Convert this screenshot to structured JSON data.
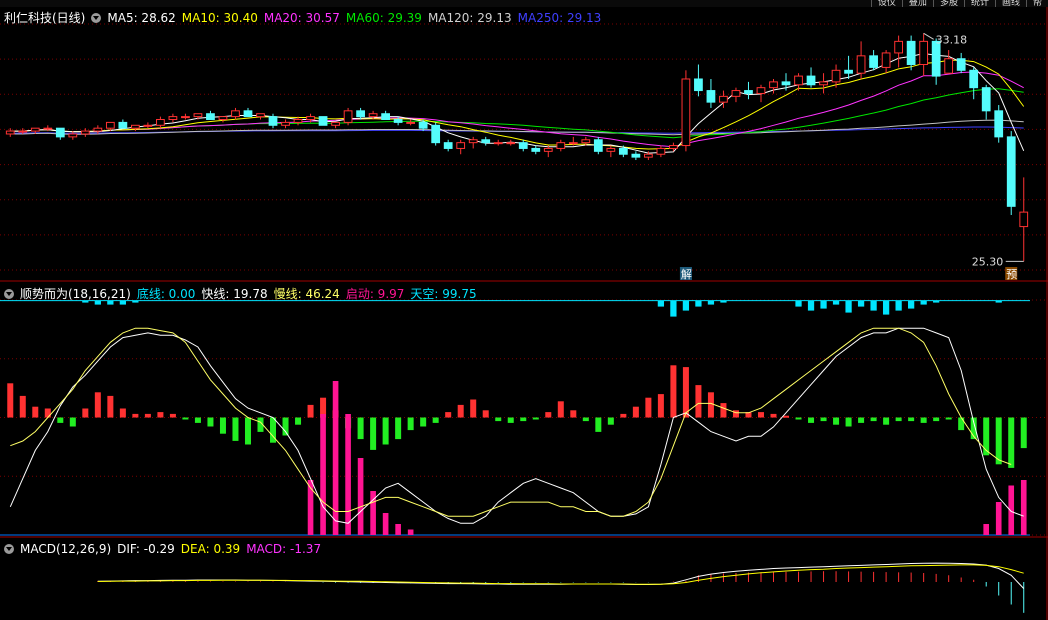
{
  "toolbar": {
    "right_buttons": [
      "设仪",
      "叠加",
      "多股",
      "统计",
      "画线",
      "帮"
    ]
  },
  "colors": {
    "up": "#ff3232",
    "down": "#54fcfc",
    "ma5": "#ffffff",
    "ma10": "#ffff00",
    "ma20": "#ff33ff",
    "ma60": "#00e600",
    "ma120": "#c0c0c0",
    "ma250": "#3f3fff",
    "fast": "#ffffff",
    "slow": "#ffff66",
    "start": "#ff1493",
    "sky": "#00e5ff",
    "grid": "#7a0000"
  },
  "main_legend": {
    "name": "利仁科技(日线)",
    "ma5": "MA5: 28.62",
    "ma10": "MA10: 30.40",
    "ma20": "MA20: 30.57",
    "ma60": "MA60: 29.39",
    "ma120": "MA120: 29.13",
    "ma250": "MA250: 29.13"
  },
  "ind_legend": {
    "name": "顺势而为(18,16,21)",
    "base": "底线: 0.00",
    "fast": "快线: 19.78",
    "slow": "慢线: 46.24",
    "start": "启动: 9.97",
    "sky": "天空: 99.75"
  },
  "macd_legend": {
    "name": "MACD(12,26,9)",
    "dif": "DIF: -0.29",
    "dea": "DEA: 0.39",
    "macd": "MACD: -1.37"
  },
  "chart_data": {
    "type": "candlestick",
    "high_label": "33.18",
    "low_label": "25.30",
    "markers": {
      "unlock": "解",
      "forecast": "预"
    },
    "price_range": [
      25.0,
      33.5
    ],
    "candles": [
      [
        29.7,
        29.9,
        29.6,
        29.8
      ],
      [
        29.8,
        29.9,
        29.7,
        29.8
      ],
      [
        29.8,
        29.9,
        29.7,
        29.9
      ],
      [
        29.9,
        30.0,
        29.8,
        29.9
      ],
      [
        29.9,
        29.9,
        29.5,
        29.6
      ],
      [
        29.6,
        29.8,
        29.5,
        29.7
      ],
      [
        29.7,
        29.9,
        29.6,
        29.8
      ],
      [
        29.8,
        30.0,
        29.7,
        29.9
      ],
      [
        29.9,
        30.1,
        29.8,
        30.1
      ],
      [
        30.1,
        30.2,
        29.9,
        29.9
      ],
      [
        29.9,
        30.0,
        29.8,
        30.0
      ],
      [
        30.0,
        30.1,
        29.9,
        30.0
      ],
      [
        30.0,
        30.3,
        29.9,
        30.2
      ],
      [
        30.2,
        30.4,
        30.1,
        30.3
      ],
      [
        30.3,
        30.4,
        30.2,
        30.3
      ],
      [
        30.3,
        30.4,
        30.2,
        30.4
      ],
      [
        30.4,
        30.5,
        30.2,
        30.2
      ],
      [
        30.2,
        30.3,
        30.1,
        30.3
      ],
      [
        30.3,
        30.6,
        30.2,
        30.5
      ],
      [
        30.5,
        30.6,
        30.3,
        30.3
      ],
      [
        30.3,
        30.4,
        30.2,
        30.4
      ],
      [
        30.3,
        30.4,
        29.9,
        30.0
      ],
      [
        30.0,
        30.2,
        29.9,
        30.1
      ],
      [
        30.1,
        30.3,
        30.0,
        30.2
      ],
      [
        30.2,
        30.4,
        30.1,
        30.3
      ],
      [
        30.3,
        30.3,
        30.0,
        30.0
      ],
      [
        30.0,
        30.1,
        29.9,
        30.1
      ],
      [
        30.1,
        30.6,
        30.0,
        30.5
      ],
      [
        30.5,
        30.6,
        30.2,
        30.3
      ],
      [
        30.3,
        30.5,
        30.2,
        30.4
      ],
      [
        30.4,
        30.5,
        30.2,
        30.2
      ],
      [
        30.2,
        30.3,
        30.0,
        30.1
      ],
      [
        30.1,
        30.2,
        30.0,
        30.1
      ],
      [
        30.1,
        30.2,
        29.8,
        29.9
      ],
      [
        30.0,
        30.1,
        29.3,
        29.4
      ],
      [
        29.4,
        29.5,
        29.1,
        29.2
      ],
      [
        29.2,
        29.5,
        29.0,
        29.4
      ],
      [
        29.4,
        29.6,
        29.2,
        29.5
      ],
      [
        29.5,
        29.6,
        29.3,
        29.4
      ],
      [
        29.4,
        29.5,
        29.3,
        29.4
      ],
      [
        29.4,
        29.5,
        29.3,
        29.4
      ],
      [
        29.4,
        29.5,
        29.1,
        29.2
      ],
      [
        29.2,
        29.3,
        29.0,
        29.1
      ],
      [
        29.1,
        29.3,
        28.9,
        29.2
      ],
      [
        29.2,
        29.5,
        29.1,
        29.4
      ],
      [
        29.4,
        29.6,
        29.3,
        29.4
      ],
      [
        29.4,
        29.6,
        29.3,
        29.5
      ],
      [
        29.5,
        29.6,
        29.0,
        29.1
      ],
      [
        29.1,
        29.3,
        28.9,
        29.2
      ],
      [
        29.2,
        29.3,
        28.9,
        29.0
      ],
      [
        29.0,
        29.1,
        28.8,
        28.9
      ],
      [
        28.9,
        29.1,
        28.8,
        29.0
      ],
      [
        29.0,
        29.3,
        28.9,
        29.2
      ],
      [
        29.2,
        29.4,
        29.1,
        29.3
      ],
      [
        29.3,
        31.9,
        29.1,
        31.6
      ],
      [
        31.6,
        32.1,
        31.0,
        31.2
      ],
      [
        31.2,
        31.6,
        30.6,
        30.8
      ],
      [
        30.8,
        31.2,
        30.6,
        31.0
      ],
      [
        31.0,
        31.3,
        30.8,
        31.2
      ],
      [
        31.2,
        31.5,
        30.9,
        31.1
      ],
      [
        31.1,
        31.4,
        30.8,
        31.3
      ],
      [
        31.3,
        31.6,
        31.1,
        31.5
      ],
      [
        31.5,
        31.8,
        31.2,
        31.4
      ],
      [
        31.4,
        31.8,
        31.2,
        31.7
      ],
      [
        31.7,
        32.0,
        31.3,
        31.4
      ],
      [
        31.4,
        31.8,
        31.1,
        31.5
      ],
      [
        31.5,
        32.1,
        31.3,
        31.9
      ],
      [
        31.9,
        32.4,
        31.6,
        31.8
      ],
      [
        31.8,
        32.9,
        31.6,
        32.4
      ],
      [
        32.4,
        32.6,
        31.9,
        32.0
      ],
      [
        32.0,
        32.6,
        31.8,
        32.5
      ],
      [
        32.5,
        33.1,
        32.0,
        32.9
      ],
      [
        32.9,
        33.1,
        31.9,
        32.1
      ],
      [
        32.1,
        33.18,
        31.7,
        32.9
      ],
      [
        32.9,
        33.0,
        31.4,
        31.7
      ],
      [
        31.8,
        32.6,
        31.8,
        32.3
      ],
      [
        32.3,
        32.5,
        31.8,
        31.9
      ],
      [
        31.9,
        32.0,
        30.9,
        31.3
      ],
      [
        31.3,
        31.4,
        30.2,
        30.5
      ],
      [
        30.5,
        30.7,
        29.4,
        29.6
      ],
      [
        29.6,
        29.8,
        26.9,
        27.2
      ],
      [
        26.5,
        28.2,
        25.3,
        27.0
      ]
    ],
    "indicator": {
      "range": [
        0,
        100
      ],
      "histogram": [
        19,
        12,
        6,
        5,
        -3,
        -5,
        5,
        14,
        12,
        5,
        2,
        2,
        3,
        2,
        -1,
        -3,
        -5,
        -9,
        -13,
        -15,
        -8,
        -14,
        -10,
        -4,
        7,
        11,
        4,
        -6,
        -12,
        -18,
        -15,
        -12,
        -7,
        -5,
        -3,
        3,
        7,
        10,
        4,
        -2,
        -3,
        -2,
        -1,
        3,
        9,
        4,
        -2,
        -8,
        -4,
        2,
        6,
        11,
        13,
        29,
        28,
        18,
        14,
        8,
        4,
        3,
        3,
        2,
        1,
        -1,
        -3,
        -2,
        -4,
        -5,
        -3,
        -2,
        -4,
        -2,
        -2,
        -3,
        -2,
        -1,
        -7,
        -12,
        -21,
        -26,
        -28,
        -17
      ],
      "fast": [
        12,
        24,
        36,
        44,
        55,
        63,
        68,
        74,
        80,
        84,
        85,
        86,
        85,
        85,
        83,
        80,
        72,
        65,
        58,
        54,
        52,
        50,
        44,
        36,
        24,
        12,
        6,
        5,
        10,
        15,
        20,
        22,
        18,
        14,
        10,
        7,
        5,
        5,
        8,
        14,
        18,
        22,
        24,
        22,
        20,
        18,
        14,
        10,
        8,
        8,
        9,
        12,
        30,
        50,
        52,
        48,
        44,
        42,
        40,
        42,
        42,
        46,
        52,
        58,
        64,
        70,
        76,
        80,
        84,
        86,
        86,
        88,
        88,
        88,
        86,
        84,
        70,
        48,
        28,
        16,
        10,
        8
      ],
      "slow": [
        38,
        40,
        44,
        50,
        56,
        62,
        70,
        76,
        82,
        86,
        88,
        88,
        87,
        86,
        82,
        74,
        66,
        60,
        54,
        50,
        48,
        42,
        36,
        28,
        20,
        14,
        10,
        10,
        12,
        14,
        16,
        16,
        14,
        12,
        10,
        8,
        8,
        8,
        10,
        12,
        14,
        14,
        14,
        14,
        12,
        12,
        10,
        10,
        8,
        8,
        10,
        14,
        24,
        38,
        52,
        56,
        56,
        54,
        52,
        52,
        54,
        58,
        62,
        66,
        70,
        74,
        78,
        82,
        86,
        88,
        88,
        88,
        86,
        82,
        72,
        60,
        50,
        42,
        36,
        32,
        30
      ],
      "start": [
        0,
        0,
        0,
        0,
        0,
        0,
        0,
        0,
        0,
        0,
        0,
        0,
        0,
        0,
        0,
        0,
        0,
        0,
        0,
        0,
        0,
        0,
        0,
        0,
        10,
        22,
        28,
        22,
        14,
        8,
        4,
        2,
        1,
        0,
        0,
        0,
        0,
        0,
        0,
        0,
        0,
        0,
        0,
        0,
        0,
        0,
        0,
        0,
        0,
        0,
        0,
        0,
        0,
        0,
        0,
        0,
        0,
        0,
        0,
        0,
        0,
        0,
        0,
        0,
        0,
        0,
        0,
        0,
        0,
        0,
        0,
        0,
        0,
        0,
        0,
        0,
        0,
        0,
        2,
        6,
        9,
        10
      ],
      "sky_bars": [
        0,
        0,
        0,
        0,
        0,
        0,
        1,
        2,
        2,
        2,
        1,
        0,
        0,
        0,
        0,
        0,
        0,
        0,
        0,
        0,
        0,
        0,
        0,
        0,
        0,
        0,
        0,
        0,
        0,
        0,
        0,
        0,
        0,
        0,
        0,
        0,
        0,
        0,
        0,
        0,
        0,
        0,
        0,
        0,
        0,
        0,
        0,
        0,
        0,
        0,
        0,
        0,
        3,
        8,
        5,
        3,
        2,
        1,
        0,
        0,
        0,
        0,
        0,
        3,
        5,
        4,
        2,
        6,
        3,
        5,
        7,
        5,
        4,
        2,
        1,
        0,
        0,
        0,
        0,
        1,
        0,
        0
      ]
    },
    "macd": {
      "range": [
        -1.6,
        1.2
      ],
      "histogram": [
        0.05,
        0.04,
        0.03,
        0.02,
        0.02,
        0.02,
        0.03,
        0.03,
        0.03,
        0.02,
        0.02,
        0.02,
        0.02,
        0.02,
        0.02,
        0.01,
        0.0,
        0.0,
        -0.02,
        -0.03,
        -0.03,
        -0.04,
        -0.04,
        -0.04,
        -0.05,
        -0.06,
        -0.06,
        -0.05,
        -0.05,
        -0.04,
        -0.04,
        -0.04,
        -0.03,
        -0.03,
        -0.02,
        -0.02,
        -0.02,
        -0.02,
        -0.02,
        -0.02,
        -0.02,
        -0.02,
        -0.02,
        -0.01,
        -0.01,
        0.0,
        0.02,
        0.05,
        0.3,
        0.35,
        0.38,
        0.4,
        0.42,
        0.43,
        0.44,
        0.45,
        0.46,
        0.47,
        0.48,
        0.48,
        0.47,
        0.46,
        0.45,
        0.44,
        0.43,
        0.42,
        0.4,
        0.36,
        0.3,
        0.2,
        0.1,
        -0.2,
        -0.6,
        -1.0,
        -1.37
      ],
      "dif": [
        0.03,
        0.04,
        0.05,
        0.06,
        0.06,
        0.07,
        0.08,
        0.08,
        0.09,
        0.09,
        0.09,
        0.09,
        0.08,
        0.08,
        0.07,
        0.06,
        0.05,
        0.04,
        0.03,
        0.02,
        0.01,
        0.0,
        -0.01,
        -0.02,
        -0.03,
        -0.04,
        -0.05,
        -0.06,
        -0.07,
        -0.07,
        -0.08,
        -0.09,
        -0.09,
        -0.1,
        -0.1,
        -0.1,
        -0.1,
        -0.1,
        -0.09,
        -0.09,
        -0.09,
        -0.09,
        -0.1,
        -0.11,
        -0.11,
        -0.1,
        -0.05,
        0.1,
        0.25,
        0.35,
        0.42,
        0.48,
        0.52,
        0.56,
        0.6,
        0.62,
        0.64,
        0.66,
        0.68,
        0.7,
        0.72,
        0.74,
        0.76,
        0.78,
        0.8,
        0.82,
        0.83,
        0.84,
        0.83,
        0.82,
        0.8,
        0.75,
        0.6,
        0.3,
        -0.29
      ],
      "dea": [
        0.02,
        0.03,
        0.04,
        0.04,
        0.05,
        0.05,
        0.06,
        0.06,
        0.07,
        0.07,
        0.08,
        0.08,
        0.08,
        0.08,
        0.07,
        0.07,
        0.06,
        0.06,
        0.05,
        0.04,
        0.03,
        0.03,
        0.02,
        0.01,
        0.0,
        -0.01,
        -0.02,
        -0.03,
        -0.04,
        -0.05,
        -0.05,
        -0.06,
        -0.07,
        -0.07,
        -0.08,
        -0.08,
        -0.08,
        -0.09,
        -0.09,
        -0.09,
        -0.09,
        -0.09,
        -0.09,
        -0.1,
        -0.1,
        -0.1,
        -0.08,
        -0.02,
        0.08,
        0.16,
        0.24,
        0.3,
        0.36,
        0.41,
        0.45,
        0.49,
        0.52,
        0.55,
        0.57,
        0.6,
        0.62,
        0.64,
        0.66,
        0.68,
        0.7,
        0.72,
        0.73,
        0.74,
        0.75,
        0.76,
        0.76,
        0.74,
        0.68,
        0.55,
        0.39
      ]
    }
  }
}
